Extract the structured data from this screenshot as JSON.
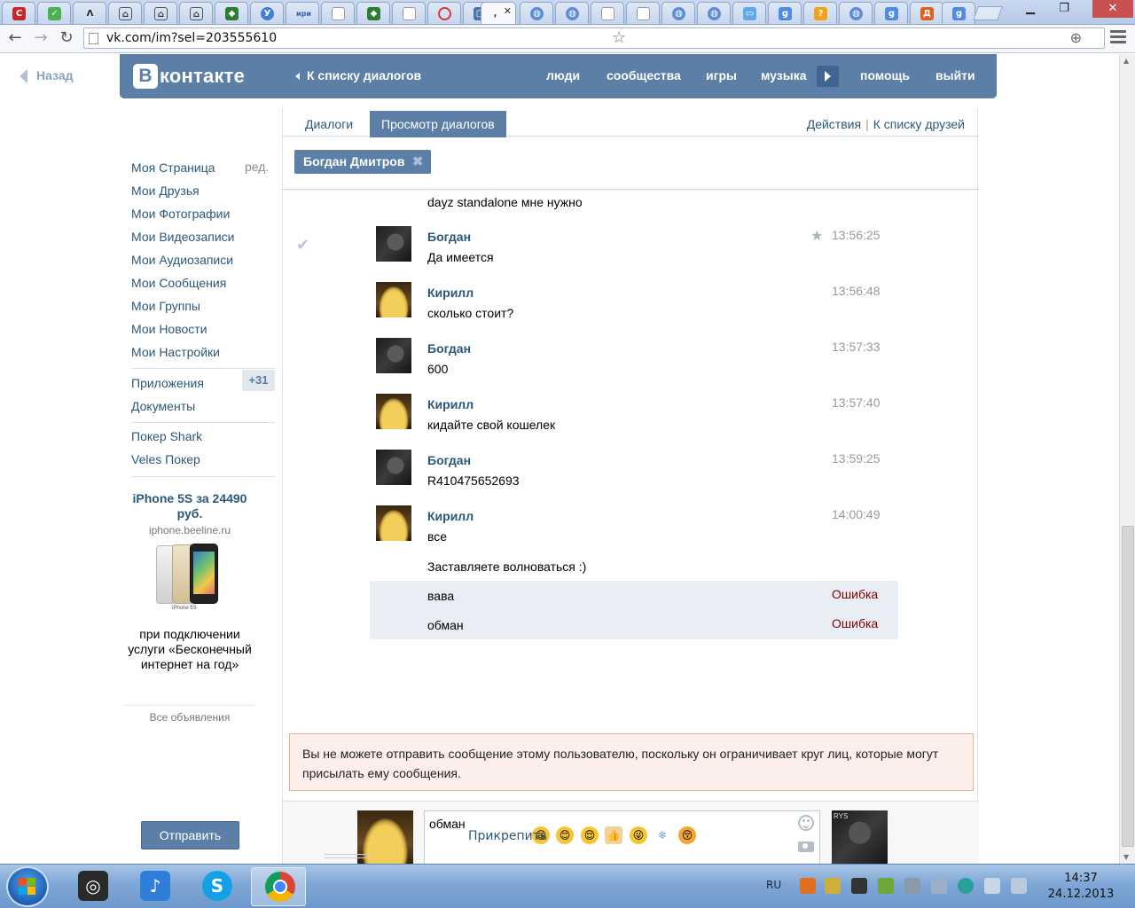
{
  "browser": {
    "url": "vk.com/im?sel=203555610",
    "tab_count": 27,
    "active_tab_title": ","
  },
  "page": {
    "back_label": "Назад"
  },
  "header": {
    "logo_letter": "В",
    "logo_text": "контакте",
    "dialogs_link": "К списку диалогов",
    "nav": [
      "люди",
      "сообщества",
      "игры",
      "музыка",
      "помощь",
      "выйти"
    ]
  },
  "sidebar": {
    "items": [
      "Моя Страница",
      "Мои Друзья",
      "Мои Фотографии",
      "Мои Видеозаписи",
      "Мои Аудиозаписи",
      "Мои Сообщения",
      "Мои Группы",
      "Мои Новости",
      "Мои Настройки"
    ],
    "edit_label": "ред.",
    "apps_label": "Приложения",
    "apps_badge": "+31",
    "docs_label": "Документы",
    "extra_links": [
      "Покер Shark",
      "Veles Покер"
    ]
  },
  "ad": {
    "title": "iPhone 5S за 24490 руб.",
    "domain": "iphone.beeline.ru",
    "image_caption": "iPhone 5S",
    "text": "при подключении услуги «Бесконечный интернет на год»",
    "all_label": "Все объявления"
  },
  "dialog": {
    "tabs": [
      "Диалоги",
      "Просмотр диалогов"
    ],
    "actions": [
      "Действия",
      "К списку друзей"
    ],
    "peer_name": "Богдан Дмитров",
    "messages": [
      {
        "author": "",
        "text": "dayz standalone мне нужно",
        "time": ""
      },
      {
        "author": "Богдан",
        "text": "Да имеется",
        "time": "13:56:25"
      },
      {
        "author": "Кирилл",
        "text": "сколько стоит?",
        "time": "13:56:48"
      },
      {
        "author": "Богдан",
        "text": "600",
        "time": "13:57:33"
      },
      {
        "author": "Кирилл",
        "text": "кидайте свой кошелек",
        "time": "13:57:40"
      },
      {
        "author": "Богдан",
        "text": "R410475652693",
        "time": "13:59:25"
      },
      {
        "author": "Кирилл",
        "text": "все",
        "time": "14:00:49"
      },
      {
        "author": "",
        "text": "Заставляете волноваться :)",
        "time": ""
      }
    ],
    "failed_messages": [
      {
        "text": "вава",
        "status": "Ошибка"
      },
      {
        "text": "обман",
        "status": "Ошибка"
      }
    ],
    "notice": "Вы не можете отправить сообщение этому пользователю, поскольку он ограничивает круг лиц, которые могут присылать ему сообщения.",
    "input_value": "обман",
    "send_label": "Отправить",
    "attach_label": "Прикрепить",
    "peer_avatar_tag": "RYS"
  },
  "taskbar": {
    "lang": "RU",
    "time": "14:37",
    "date": "24.12.2013"
  }
}
